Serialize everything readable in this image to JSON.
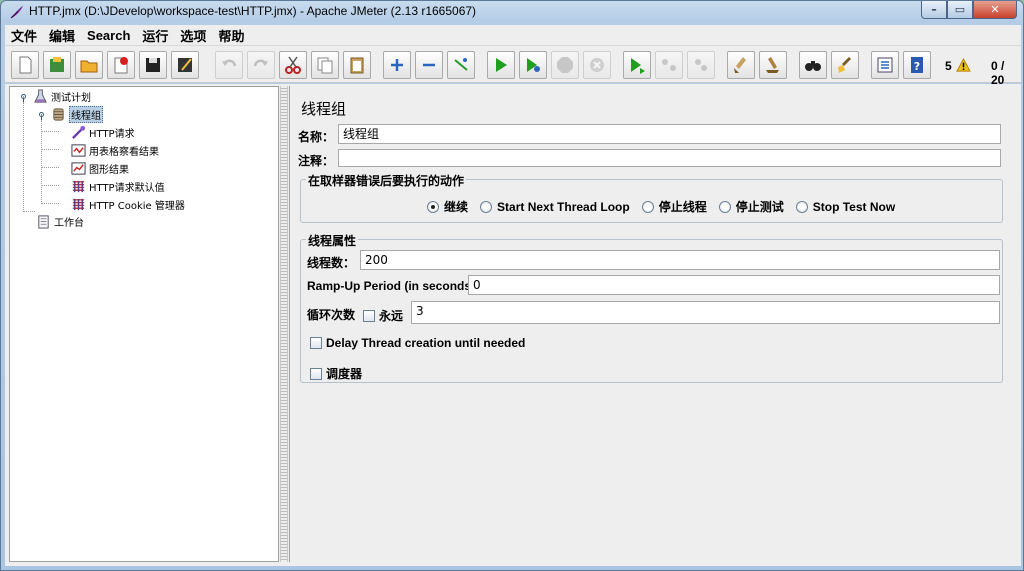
{
  "window": {
    "title": "HTTP.jmx (D:\\JDevelop\\workspace-test\\HTTP.jmx) - Apache JMeter (2.13 r1665067)",
    "controls": {
      "minimize": "–",
      "maximize": "▭",
      "close": "✕"
    }
  },
  "menu": [
    "文件",
    "编辑",
    "Search",
    "运行",
    "选项",
    "帮助"
  ],
  "toolbar": {
    "buttons": [
      {
        "name": "new-icon"
      },
      {
        "name": "templates-icon"
      },
      {
        "name": "open-icon"
      },
      {
        "name": "close-file-icon"
      },
      {
        "name": "save-icon"
      },
      {
        "name": "save-as-icon"
      },
      {
        "name": "undo-icon"
      },
      {
        "name": "redo-icon"
      },
      {
        "name": "cut-icon"
      },
      {
        "name": "copy-icon"
      },
      {
        "name": "paste-icon"
      },
      {
        "name": "expand-icon"
      },
      {
        "name": "collapse-icon"
      },
      {
        "name": "toggle-icon"
      },
      {
        "name": "start-icon"
      },
      {
        "name": "start-no-pause-icon"
      },
      {
        "name": "stop-icon"
      },
      {
        "name": "shutdown-icon"
      },
      {
        "name": "remote-start-icon"
      },
      {
        "name": "remote-stop-icon"
      },
      {
        "name": "remote-shutdown-icon"
      },
      {
        "name": "clear-icon"
      },
      {
        "name": "clear-all-icon"
      },
      {
        "name": "search-icon"
      },
      {
        "name": "reset-search-icon"
      },
      {
        "name": "function-helper-icon"
      },
      {
        "name": "help-icon"
      }
    ],
    "error_count": "5",
    "thread_count": "0 / 20"
  },
  "tree": {
    "nodes": [
      {
        "label": "测试计划"
      },
      {
        "label": "线程组"
      },
      {
        "label": "HTTP请求"
      },
      {
        "label": "用表格察看结果"
      },
      {
        "label": "图形结果"
      },
      {
        "label": "HTTP请求默认值"
      },
      {
        "label": "HTTP Cookie 管理器"
      },
      {
        "label": "工作台"
      }
    ]
  },
  "panel": {
    "title": "线程组",
    "name_label": "名称：",
    "name_value": "线程组",
    "comment_label": "注释：",
    "comment_value": "",
    "on_error": {
      "title": "在取样器错误后要执行的动作",
      "options": [
        "继续",
        "Start Next Thread Loop",
        "停止线程",
        "停止测试",
        "Stop Test Now"
      ],
      "selected": "继续"
    },
    "thread_props": {
      "title": "线程属性",
      "threads_label": "线程数：",
      "threads_value": "200",
      "rampup_label": "Ramp-Up Period (in seconds):",
      "rampup_value": "0",
      "loop_label": "循环次数",
      "forever_label": "永远",
      "loop_value": "3",
      "delay_label": "Delay Thread creation until needed",
      "scheduler_label": "调度器"
    }
  },
  "colors": {
    "selection": "#b8cfe5",
    "window_frame": "#a9c5e2",
    "panel_bg": "#eeeeee"
  }
}
